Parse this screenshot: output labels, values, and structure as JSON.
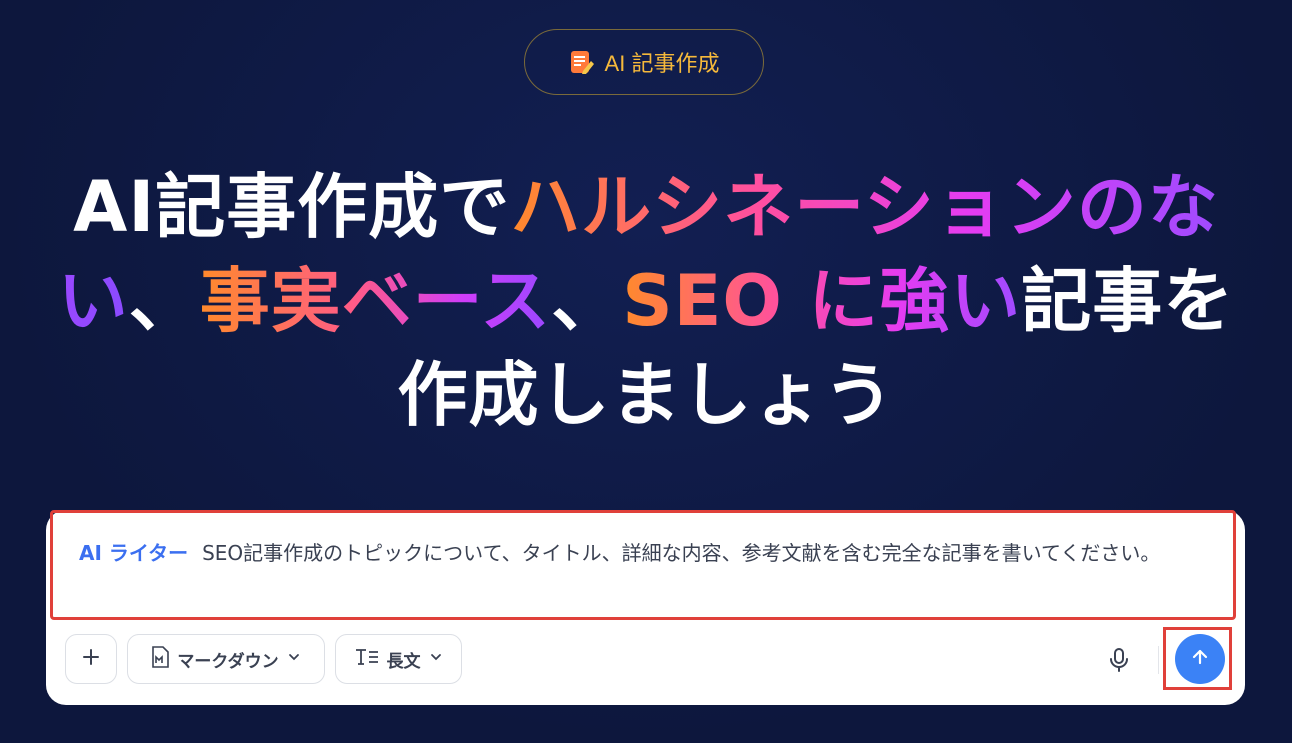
{
  "badge": {
    "label": "AI 記事作成",
    "icon": "edit-note-icon"
  },
  "headline": {
    "line1_white": "AI記事作成で",
    "line1_grad": "ハルシネーションのな",
    "line2_grad_a": "い",
    "line2_white_a": "、",
    "line2_grad_b": "事実ベース",
    "line2_white_b": "、",
    "line2_grad_c": "SEO に強い",
    "line2_white_c": "記事を",
    "line3_white": "作成しましょう"
  },
  "prompt": {
    "tag": "AI ライター",
    "text": "SEO記事作成のトピックについて、タイトル、詳細な内容、参考文献を含む完全な記事を書いてください。"
  },
  "toolbar": {
    "format_label": "マークダウン",
    "length_label": "長文"
  },
  "colors": {
    "background": "#0f1a45",
    "accent": "#3b82f6",
    "badge_text": "#f6b93b",
    "highlight_box": "#e0403a"
  }
}
